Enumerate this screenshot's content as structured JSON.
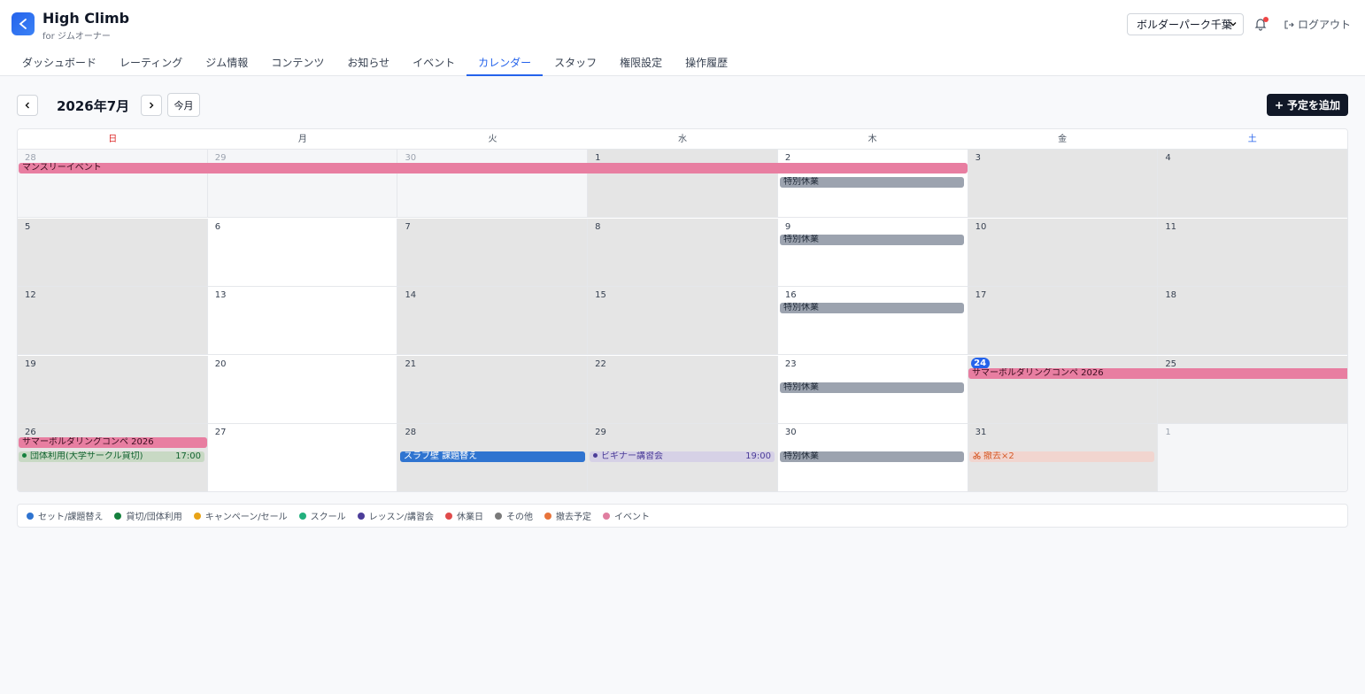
{
  "app": {
    "title": "High Climb",
    "subtitle": "for ジムオーナー"
  },
  "header": {
    "gym_select": "ボルダーパーク千葉",
    "logout_label": "ログアウト"
  },
  "nav": [
    {
      "label": "ダッシュボード",
      "active": false
    },
    {
      "label": "レーティング",
      "active": false
    },
    {
      "label": "ジム情報",
      "active": false
    },
    {
      "label": "コンテンツ",
      "active": false
    },
    {
      "label": "お知らせ",
      "active": false
    },
    {
      "label": "イベント",
      "active": false
    },
    {
      "label": "カレンダー",
      "active": true
    },
    {
      "label": "スタッフ",
      "active": false
    },
    {
      "label": "権限設定",
      "active": false
    },
    {
      "label": "操作履歴",
      "active": false
    }
  ],
  "toolbar": {
    "month": "2026年7月",
    "today_label": "今月",
    "add_label": "予定を追加"
  },
  "calendar": {
    "weekdays": [
      "日",
      "月",
      "火",
      "水",
      "木",
      "金",
      "土"
    ],
    "weeks": [
      {
        "days": [
          {
            "n": "28",
            "type": "other"
          },
          {
            "n": "29",
            "type": "other"
          },
          {
            "n": "30",
            "type": "other"
          },
          {
            "n": "1",
            "type": "gray"
          },
          {
            "n": "2",
            "type": "white"
          },
          {
            "n": "3",
            "type": "gray"
          },
          {
            "n": "4",
            "type": "gray"
          }
        ]
      },
      {
        "days": [
          {
            "n": "5",
            "type": "gray"
          },
          {
            "n": "6",
            "type": "white"
          },
          {
            "n": "7",
            "type": "gray"
          },
          {
            "n": "8",
            "type": "gray"
          },
          {
            "n": "9",
            "type": "white"
          },
          {
            "n": "10",
            "type": "gray"
          },
          {
            "n": "11",
            "type": "gray"
          }
        ]
      },
      {
        "days": [
          {
            "n": "12",
            "type": "gray"
          },
          {
            "n": "13",
            "type": "white"
          },
          {
            "n": "14",
            "type": "gray"
          },
          {
            "n": "15",
            "type": "gray"
          },
          {
            "n": "16",
            "type": "white"
          },
          {
            "n": "17",
            "type": "gray"
          },
          {
            "n": "18",
            "type": "gray"
          }
        ]
      },
      {
        "days": [
          {
            "n": "19",
            "type": "gray"
          },
          {
            "n": "20",
            "type": "white"
          },
          {
            "n": "21",
            "type": "gray"
          },
          {
            "n": "22",
            "type": "gray"
          },
          {
            "n": "23",
            "type": "white"
          },
          {
            "n": "24",
            "type": "today"
          },
          {
            "n": "25",
            "type": "gray"
          }
        ]
      },
      {
        "days": [
          {
            "n": "26",
            "type": "gray"
          },
          {
            "n": "27",
            "type": "white"
          },
          {
            "n": "28",
            "type": "gray"
          },
          {
            "n": "29",
            "type": "gray"
          },
          {
            "n": "30",
            "type": "white"
          },
          {
            "n": "31",
            "type": "gray"
          },
          {
            "n": "1",
            "type": "other"
          }
        ]
      }
    ],
    "events": {
      "monthly": "マンスリーイベント",
      "special_holiday": "特別休業",
      "summer_comp": "サマーボルダリングコンペ 2026",
      "group_use": "団体利用(大学サークル貸切)",
      "group_use_time": "17:00",
      "slab_reset": "スラブ壁 課題替え",
      "beginner_class": "ビギナー講習会",
      "beginner_time": "19:00",
      "removal": "撤去×2"
    }
  },
  "legend": [
    {
      "label": "セット/課題替え",
      "color": "#2f74d0"
    },
    {
      "label": "貸切/団体利用",
      "color": "#15803d"
    },
    {
      "label": "キャンペーン/セール",
      "color": "#e8a317"
    },
    {
      "label": "スクール",
      "color": "#22b07d"
    },
    {
      "label": "レッスン/講習会",
      "color": "#4c3d99"
    },
    {
      "label": "休業日",
      "color": "#e04b4b"
    },
    {
      "label": "その他",
      "color": "#7a7a7a"
    },
    {
      "label": "撤去予定",
      "color": "#e8743b"
    },
    {
      "label": "イベント",
      "color": "#e07ea0"
    }
  ]
}
